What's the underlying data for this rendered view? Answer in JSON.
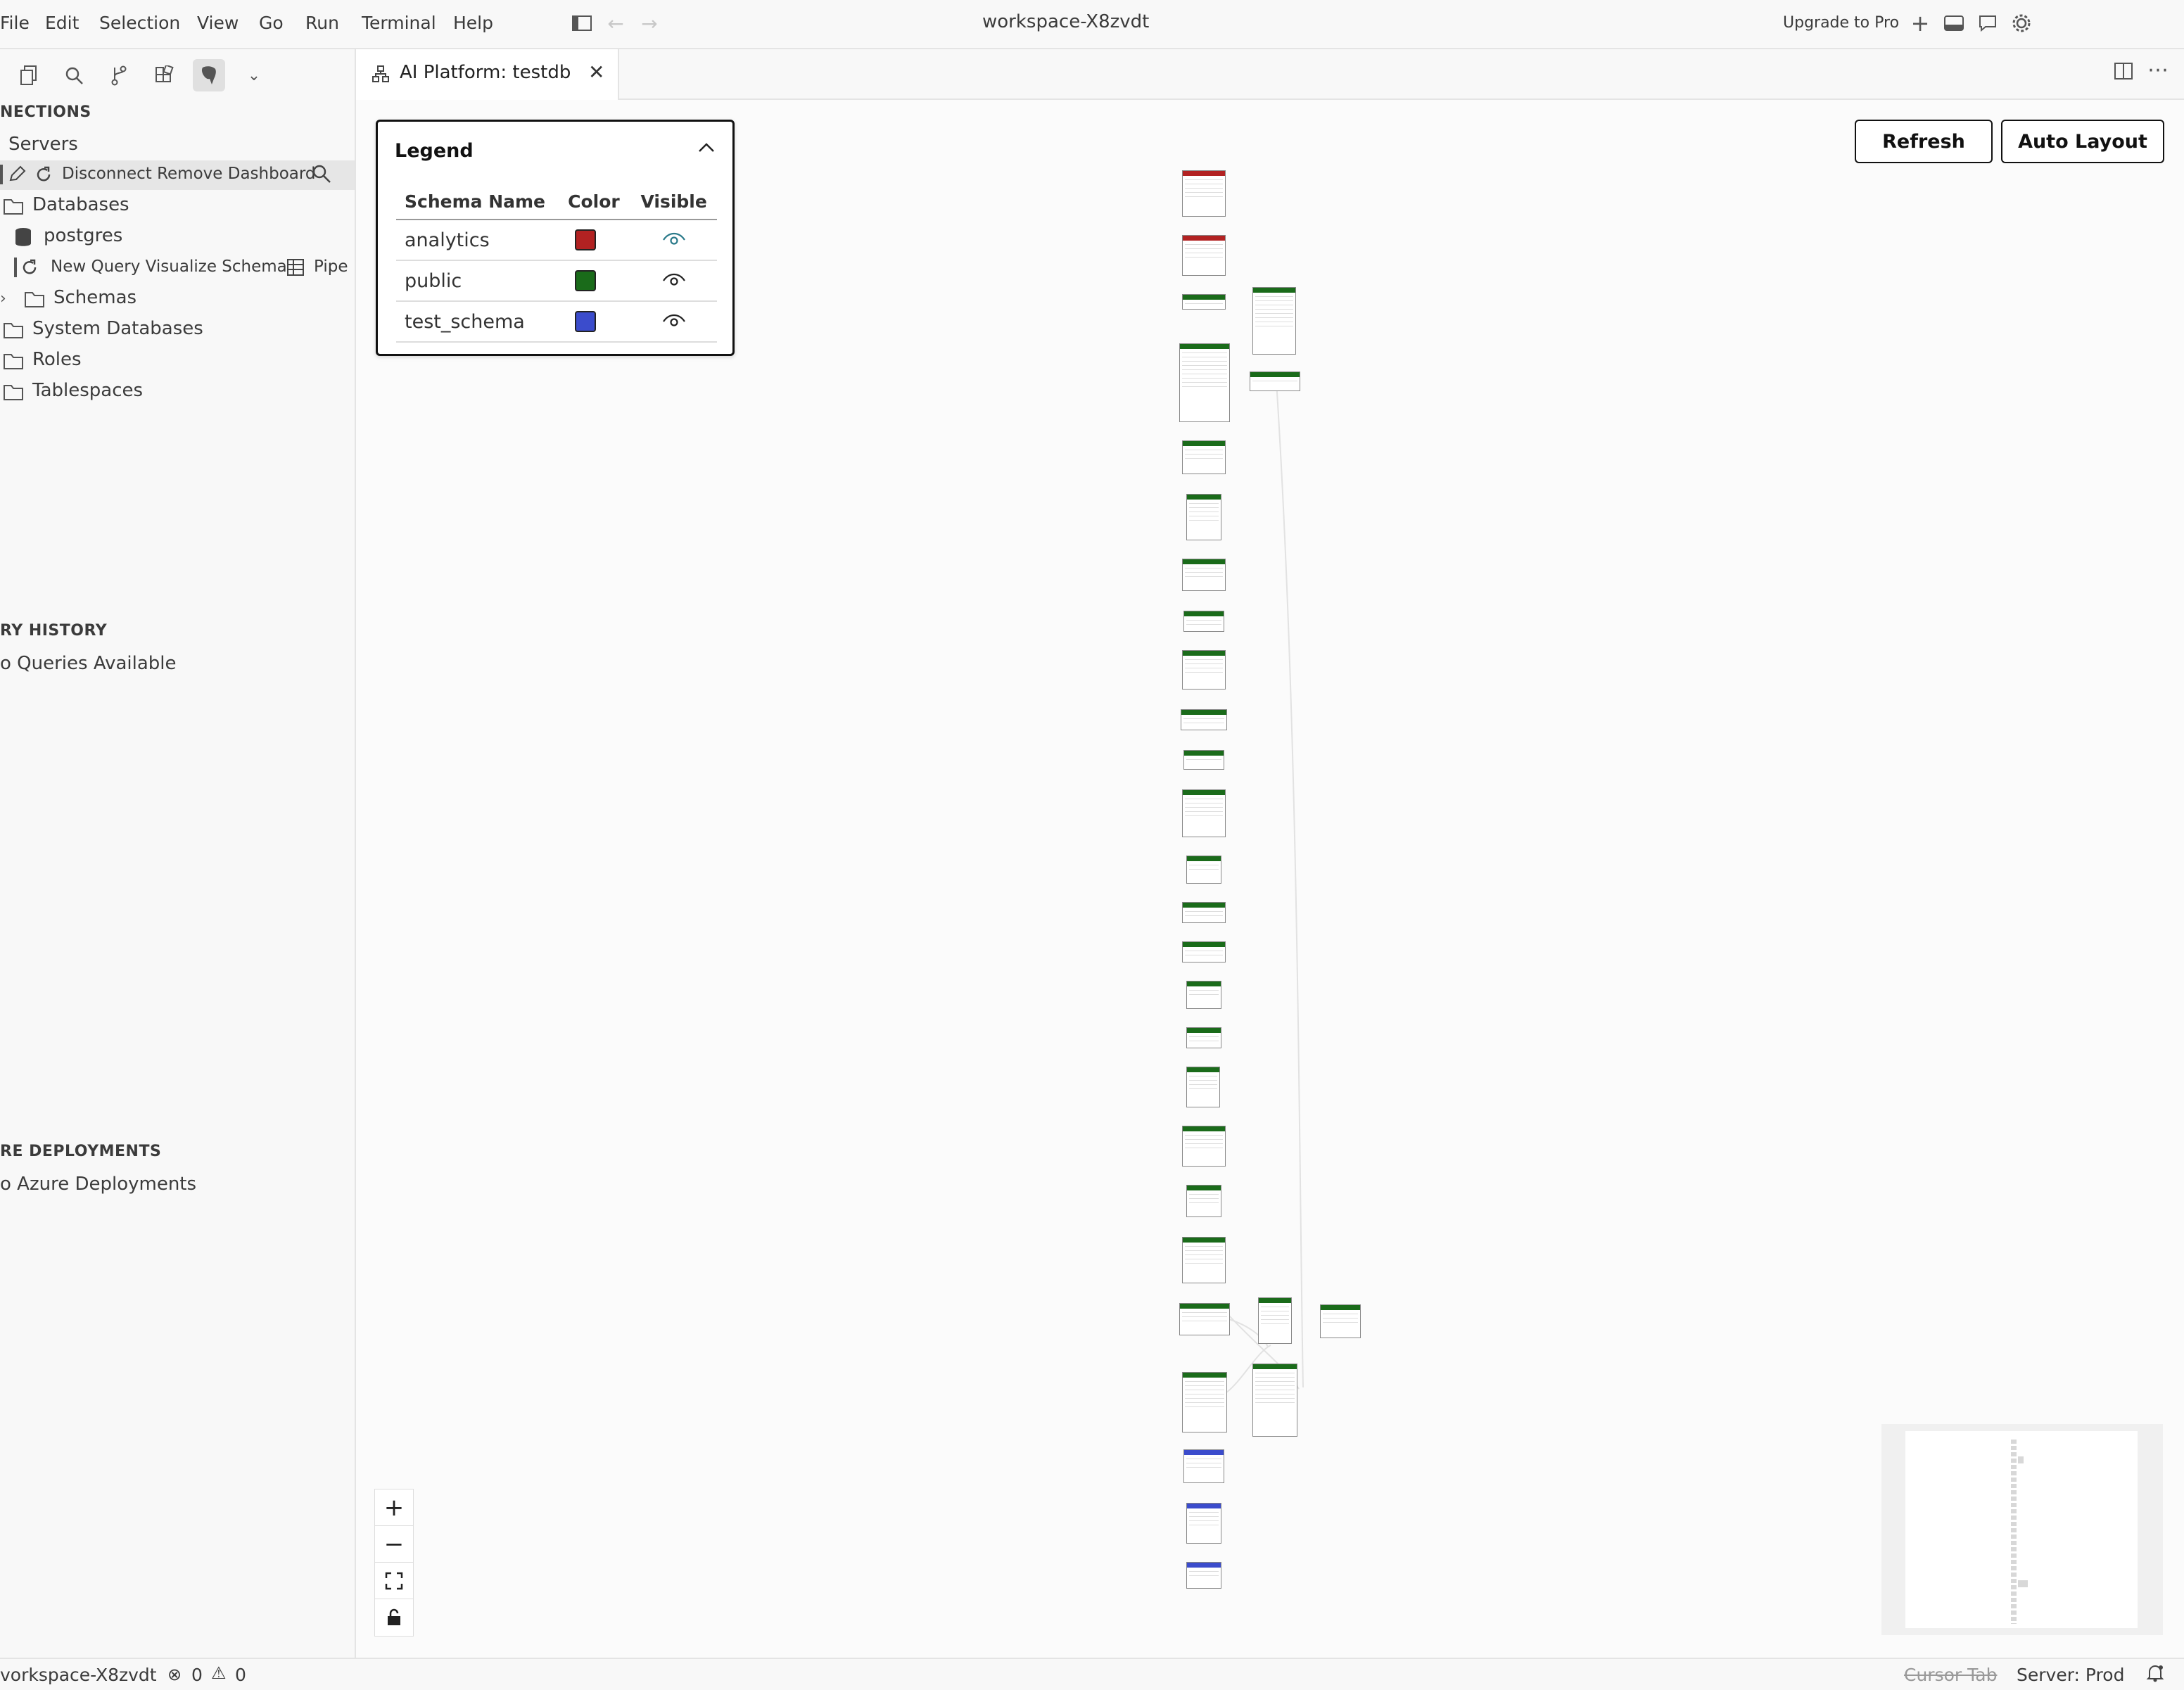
{
  "menu": [
    "File",
    "Edit",
    "Selection",
    "View",
    "Go",
    "Run",
    "Terminal",
    "Help"
  ],
  "window_title": "workspace-X8zvdt",
  "upgrade_label": "Upgrade to Pro",
  "sidebar": {
    "connections_title": "NECTIONS",
    "servers_label": "Servers",
    "server_actions": "Disconnect Remove Dashboard",
    "databases_label": "Databases",
    "db_name": "postgres",
    "db_actions": "New Query Visualize Schema",
    "db_extra": "Pipe",
    "schemas_label": "Schemas",
    "system_databases_label": "System Databases",
    "roles_label": "Roles",
    "tablespaces_label": "Tablespaces",
    "history_title": "RY HISTORY",
    "history_empty": "o Queries Available",
    "deploy_title": "RE DEPLOYMENTS",
    "deploy_empty": "o Azure Deployments"
  },
  "tab": {
    "label": "AI Platform: testdb"
  },
  "legend": {
    "title": "Legend",
    "headers": [
      "Schema Name",
      "Color",
      "Visible"
    ],
    "rows": [
      {
        "name": "analytics",
        "color": "#b22222"
      },
      {
        "name": "public",
        "color": "#1a6b1a"
      },
      {
        "name": "test_schema",
        "color": "#3b4ccc"
      }
    ]
  },
  "buttons": {
    "refresh": "Refresh",
    "auto_layout": "Auto Layout"
  },
  "status": {
    "workspace": "vorkspace-X8zvdt",
    "errors": "0",
    "warnings": "0",
    "cursor_tab": "Cursor Tab",
    "server": "Server: Prod"
  }
}
